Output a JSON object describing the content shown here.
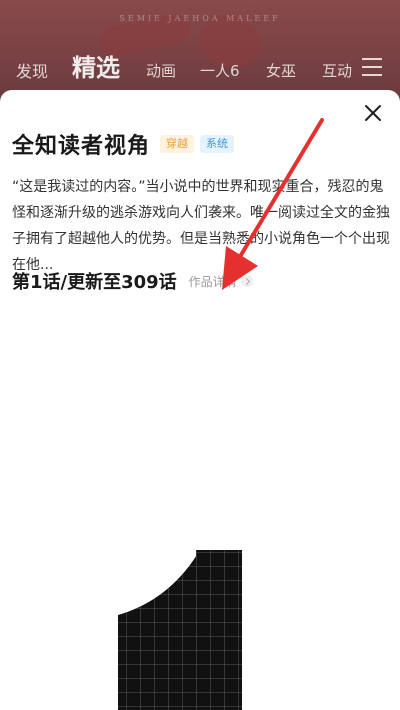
{
  "banner_text": "SEMIE JAEHOA MALEEF",
  "nav": {
    "tabs": [
      {
        "label": "发现"
      },
      {
        "label": "精选",
        "active": true
      },
      {
        "label": "动画"
      },
      {
        "label": "一人6"
      },
      {
        "label": "女巫"
      },
      {
        "label": "互动"
      }
    ],
    "menu_icon": "hamburger-menu-icon"
  },
  "sheet": {
    "title": "全知读者视角",
    "tags": [
      "穿越",
      "系统"
    ],
    "tag_colors": [
      "#f0a030",
      "#3a9ad9"
    ],
    "description": "“这是我读过的内容。”当小说中的世界和现实重合，残忍的鬼怪和逐渐升级的逃杀游戏向人们袭来。唯一阅读过全文的金独子拥有了超越他人的优势。但是当熟悉的小说角色一个个出现在他...",
    "chapter": "第1话/更新至309话",
    "detail_link": "作品详情",
    "close_icon": "close-icon"
  },
  "cover_art": {
    "numeral": "1",
    "fill": "#111111",
    "grid_color": "#555555"
  },
  "annotation": {
    "arrow_color": "#e53030"
  }
}
